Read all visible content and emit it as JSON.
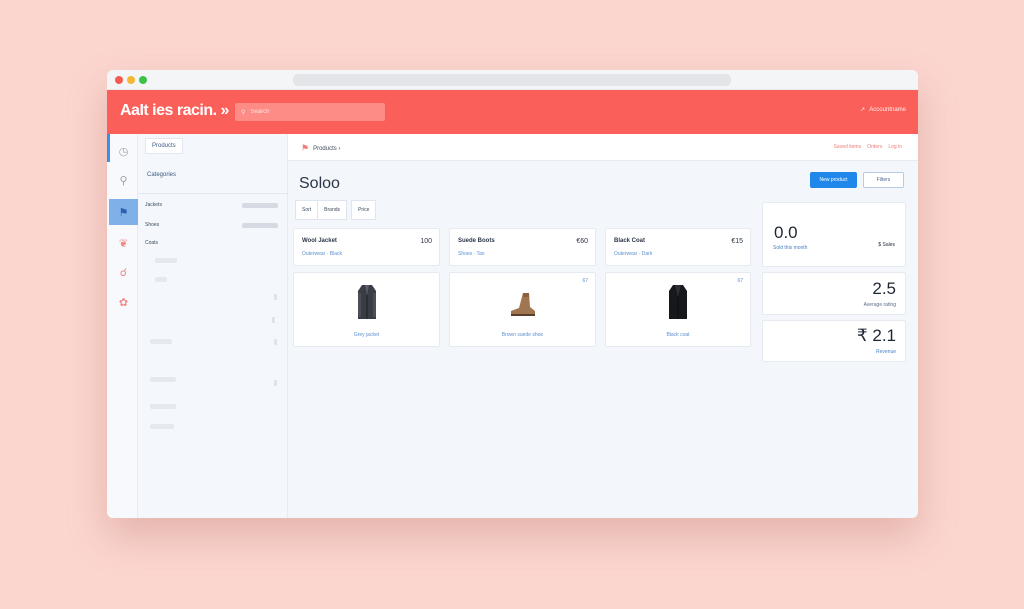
{
  "window": {
    "controls": [
      "close",
      "minimize",
      "maximize"
    ]
  },
  "header": {
    "brand": "AaIt ies racin. »",
    "search_placeholder": "Search",
    "search_icon": "search-icon",
    "right_link": "Accountname",
    "right_icon": "arrow-icon"
  },
  "icon_rail": {
    "items": [
      {
        "name": "home-icon",
        "glyph": "◷"
      },
      {
        "name": "bag-icon",
        "glyph": "⚲"
      },
      {
        "name": "tag-icon",
        "glyph": "⚑"
      },
      {
        "name": "heart-icon",
        "glyph": "❦"
      },
      {
        "name": "pin-icon",
        "glyph": "☌"
      },
      {
        "name": "gift-icon",
        "glyph": "✿"
      }
    ]
  },
  "sidebar": {
    "tab": "Products",
    "section": "Categories",
    "rows": [
      {
        "label": "Jackets"
      },
      {
        "label": "Shoes"
      },
      {
        "label": "Coats"
      }
    ]
  },
  "subheader": {
    "crumb_icon": "tag-icon",
    "crumb": "Products ›",
    "right_items": [
      "Saved items",
      "Orders",
      "Log in"
    ]
  },
  "main": {
    "title": "Soloo",
    "primary_button": "New product",
    "secondary_button": "Filters",
    "filters": [
      "Sort",
      "Brands",
      "Price"
    ]
  },
  "summary_cards": [
    {
      "name": "Wool Jacket",
      "price": "100",
      "sub": "Outerwear · Black"
    },
    {
      "name": "Suede Boots",
      "price": "€60",
      "sub": "Shoes · Tan"
    },
    {
      "name": "Black Coat",
      "price": "€15",
      "sub": "Outerwear · Dark"
    }
  ],
  "product_cards": [
    {
      "badge": "",
      "caption": "Grey jacket",
      "thumb": "jacket-image"
    },
    {
      "badge": "67",
      "caption": "Brown suede shoe",
      "thumb": "shoe-image"
    },
    {
      "badge": "67",
      "caption": "Black coat",
      "thumb": "coat-image"
    }
  ],
  "stats": [
    {
      "value": "0.0",
      "left_label": "Sold this month",
      "right_label": "$ Sales"
    },
    {
      "value": "2.5",
      "label": "Average rating"
    },
    {
      "value": "₹ 2.1",
      "label": "Revenue"
    }
  ],
  "colors": {
    "brand": "#fb5f5a",
    "accent": "#1f86ea",
    "background": "#fbd6cf"
  }
}
